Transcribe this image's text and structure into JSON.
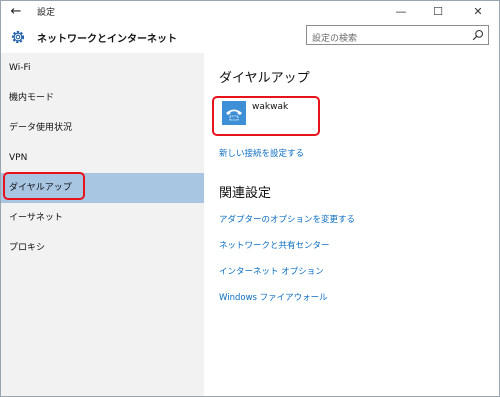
{
  "titlebar": {
    "back_glyph": "←",
    "title": "設定",
    "minimize_glyph": "—",
    "maximize_glyph": "☐",
    "close_glyph": "✕"
  },
  "header": {
    "title": "ネットワークとインターネット",
    "search_placeholder": "設定の検索"
  },
  "sidebar": {
    "items": [
      {
        "label": "Wi-Fi"
      },
      {
        "label": "機内モード"
      },
      {
        "label": "データ使用状況"
      },
      {
        "label": "VPN"
      },
      {
        "label": "ダイヤルアップ"
      },
      {
        "label": "イーサネット"
      },
      {
        "label": "プロキシ"
      }
    ],
    "selected_index": 4
  },
  "main": {
    "dialup_title": "ダイヤルアップ",
    "connection_name": "wakwak",
    "new_connection_link": "新しい接続を設定する",
    "related_title": "関連設定",
    "related_links": [
      {
        "label": "アダプターのオプションを変更する"
      },
      {
        "label": "ネットワークと共有センター"
      },
      {
        "label": "インターネット オプション"
      },
      {
        "label": "Windows ファイアウォール"
      }
    ]
  },
  "colors": {
    "accent": "#0a6cc1",
    "selected_bg": "#a8c5e2",
    "highlight_border": "#e8121a",
    "dialup_icon_bg": "#3d8fd6"
  },
  "icons": {
    "gear": "gear-icon",
    "search": "search-icon",
    "dialup": "phone-icon"
  }
}
